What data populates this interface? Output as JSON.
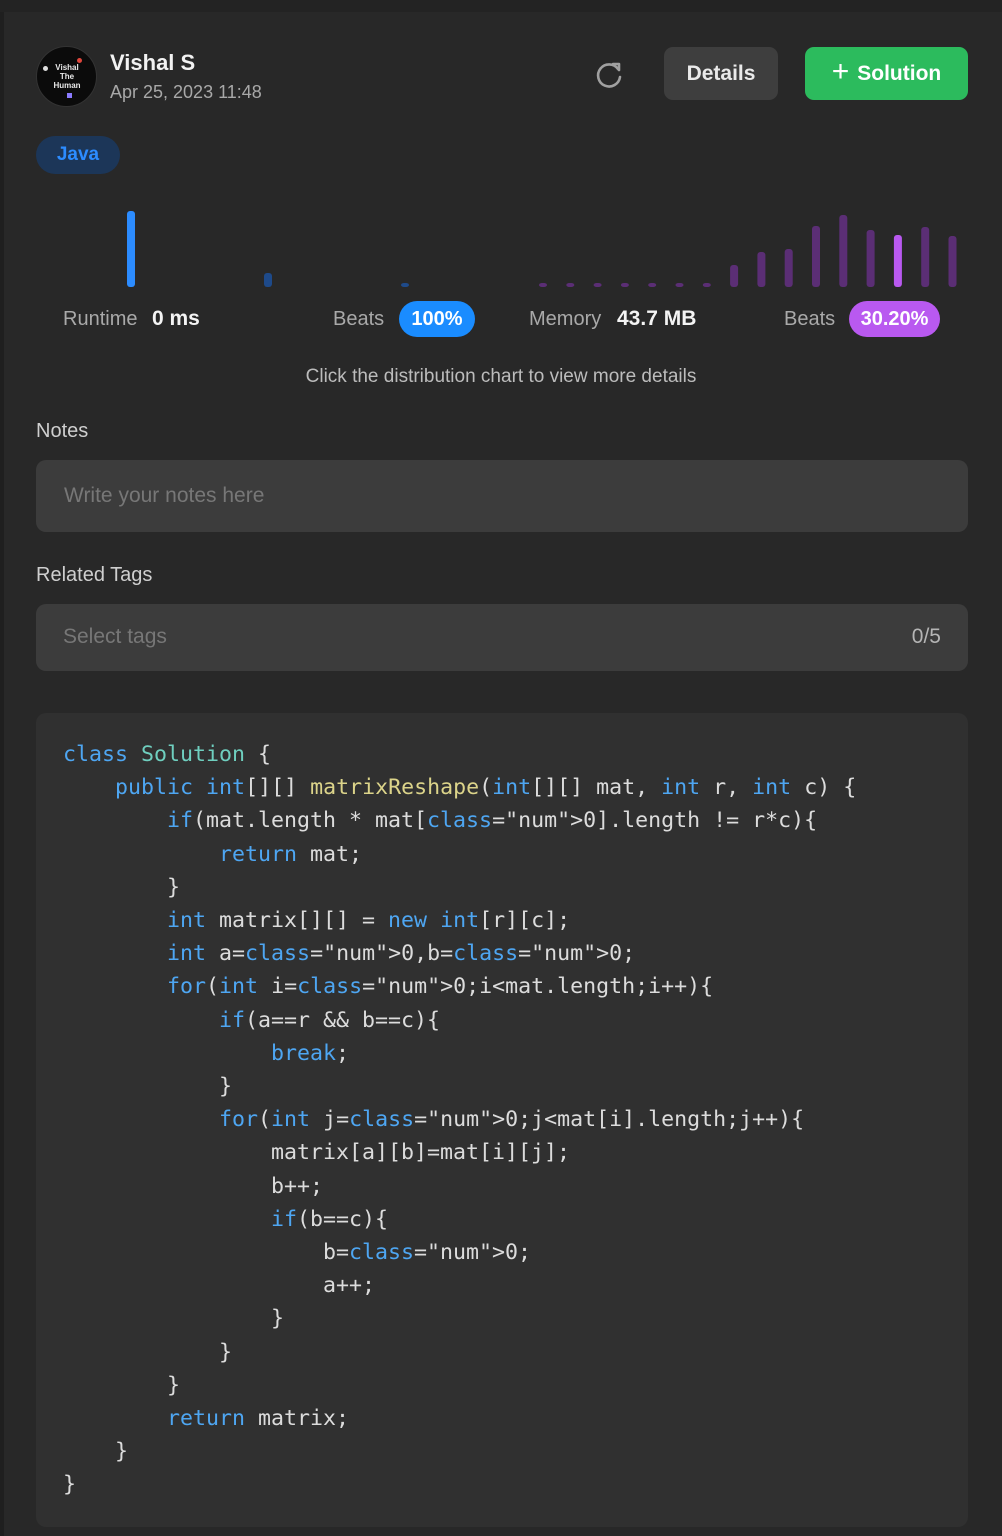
{
  "user": {
    "name": "Vishal S",
    "date": "Apr 25, 2023 11:48",
    "avatar_text": "Vishal The Human"
  },
  "header": {
    "details_label": "Details",
    "solution_label": "Solution",
    "solution_icon": "plus-icon",
    "refresh_icon": "refresh-icon"
  },
  "language": "Java",
  "stats": {
    "runtime_label": "Runtime",
    "runtime_value": "0 ms",
    "runtime_beats_label": "Beats",
    "runtime_beats_value": "100%",
    "memory_label": "Memory",
    "memory_value": "43.7 MB",
    "memory_beats_label": "Beats",
    "memory_beats_value": "30.20%"
  },
  "chart_hint": "Click the distribution chart to view more details",
  "notes": {
    "label": "Notes",
    "placeholder": "Write your notes here"
  },
  "tags": {
    "label": "Related Tags",
    "placeholder": "Select tags",
    "count": "0/5"
  },
  "colors": {
    "runtime_accent": "#2c8cff",
    "memory_accent": "#b959f0",
    "solution_green": "#2cbb5d",
    "panel_bg": "#282828",
    "runtime_bars_dim": "#1e4a8a",
    "memory_bars_dim": "#5b2e75"
  },
  "chart_data": [
    {
      "type": "bar",
      "name": "runtime-distribution",
      "values": [
        76,
        14,
        4
      ],
      "highlight_index": 0
    },
    {
      "type": "bar",
      "name": "memory-distribution",
      "values": [
        4,
        4,
        4,
        4,
        4,
        4,
        4,
        22,
        35,
        38,
        61,
        72,
        57,
        52,
        60,
        51
      ],
      "highlight_index": 13
    }
  ],
  "code": {
    "language": "Java",
    "lines": [
      "class Solution {",
      "    public int[][] matrixReshape(int[][] mat, int r, int c) {",
      "        if(mat.length * mat[0].length != r*c){",
      "            return mat;",
      "        }",
      "        int matrix[][] = new int[r][c];",
      "        int a=0,b=0;",
      "        for(int i=0;i<mat.length;i++){",
      "            if(a==r && b==c){",
      "                break;",
      "            }",
      "            for(int j=0;j<mat[i].length;j++){",
      "                matrix[a][b]=mat[i][j];",
      "                b++;",
      "                if(b==c){",
      "                    b=0;",
      "                    a++;",
      "                }",
      "            }",
      "        }",
      "        return matrix;",
      "    }",
      "}"
    ]
  }
}
